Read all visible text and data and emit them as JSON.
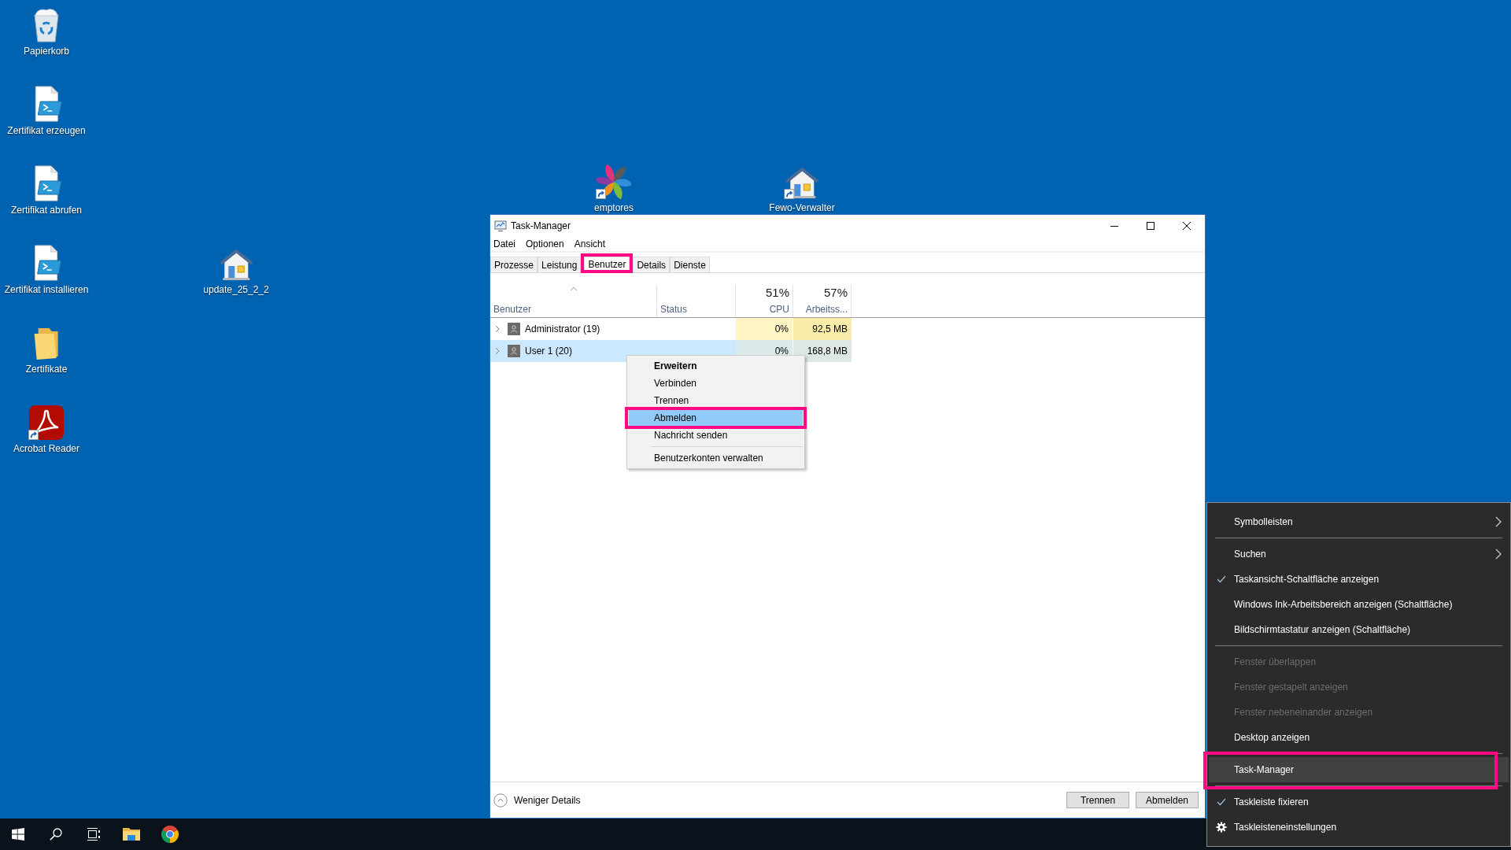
{
  "desktop_icons": [
    {
      "label": "Papierkorb",
      "kind": "recycle-bin",
      "shortcut": false
    },
    {
      "label": "Zertifikat erzeugen",
      "kind": "script",
      "shortcut": false
    },
    {
      "label": "Zertifikat abrufen",
      "kind": "script",
      "shortcut": false
    },
    {
      "label": "Zertifikat installieren",
      "kind": "script",
      "shortcut": false
    },
    {
      "label": "Zertifikate",
      "kind": "folder",
      "shortcut": false
    },
    {
      "label": "Acrobat Reader",
      "kind": "pdf-reader",
      "shortcut": true
    },
    {
      "label": "update_25_2_2",
      "kind": "house",
      "shortcut": false
    },
    {
      "label": "emptores",
      "kind": "pinwheel",
      "shortcut": true
    },
    {
      "label": "Fewo-Verwalter",
      "kind": "house",
      "shortcut": true
    }
  ],
  "task_manager": {
    "title": "Task-Manager",
    "menu": [
      "Datei",
      "Optionen",
      "Ansicht"
    ],
    "tabs": [
      {
        "label": "Prozesse",
        "selected": false,
        "framed": false
      },
      {
        "label": "Leistung",
        "selected": false,
        "framed": false
      },
      {
        "label": "Benutzer",
        "selected": true,
        "framed": true
      },
      {
        "label": "Details",
        "selected": false,
        "framed": false
      },
      {
        "label": "Dienste",
        "selected": false,
        "framed": false
      }
    ],
    "columns": [
      {
        "label": "Benutzer",
        "kind": "text",
        "sorted": true
      },
      {
        "label": "Status",
        "kind": "text",
        "sorted": false
      },
      {
        "label": "CPU",
        "kind": "metric",
        "total": "51%",
        "sorted": false
      },
      {
        "label": "Arbeitss...",
        "kind": "metric",
        "total": "57%",
        "sorted": false
      }
    ],
    "rows": [
      {
        "name": "Administrator (19)",
        "cpu": "0%",
        "memory": "92,5 MB",
        "expanded": false,
        "selected": false
      },
      {
        "name": "User 1 (20)",
        "cpu": "0%",
        "memory": "168,8 MB",
        "expanded": false,
        "selected": true
      }
    ],
    "footer": {
      "toggle": "Weniger Details",
      "buttons": [
        "Trennen",
        "Abmelden"
      ]
    }
  },
  "user_context_menu": {
    "sections": [
      [
        {
          "label": "Erweitern",
          "default": true,
          "selected": false,
          "framed": false
        },
        {
          "label": "Verbinden",
          "default": false,
          "selected": false,
          "framed": false
        },
        {
          "label": "Trennen",
          "default": false,
          "selected": false,
          "framed": false
        },
        {
          "label": "Abmelden",
          "default": false,
          "selected": true,
          "framed": true
        },
        {
          "label": "Nachricht senden",
          "default": false,
          "selected": false,
          "framed": false
        }
      ],
      [
        {
          "label": "Benutzerkonten verwalten",
          "default": false,
          "selected": false,
          "framed": false
        }
      ]
    ]
  },
  "taskbar_menu": {
    "sections": [
      [
        {
          "label": "Symbolleisten",
          "kind": "submenu",
          "checked": false,
          "disabled": false,
          "selected": false,
          "framed": false
        }
      ],
      [
        {
          "label": "Suchen",
          "kind": "submenu",
          "checked": false,
          "disabled": false,
          "selected": false,
          "framed": false
        },
        {
          "label": "Taskansicht-Schaltfläche anzeigen",
          "kind": "command",
          "checked": true,
          "disabled": false,
          "selected": false,
          "framed": false
        },
        {
          "label": "Windows Ink-Arbeitsbereich anzeigen (Schaltfläche)",
          "kind": "command",
          "checked": false,
          "disabled": false,
          "selected": false,
          "framed": false
        },
        {
          "label": "Bildschirmtastatur anzeigen (Schaltfläche)",
          "kind": "command",
          "checked": false,
          "disabled": false,
          "selected": false,
          "framed": false
        }
      ],
      [
        {
          "label": "Fenster überlappen",
          "kind": "command",
          "checked": false,
          "disabled": true,
          "selected": false,
          "framed": false
        },
        {
          "label": "Fenster gestapelt anzeigen",
          "kind": "command",
          "checked": false,
          "disabled": true,
          "selected": false,
          "framed": false
        },
        {
          "label": "Fenster nebeneinander anzeigen",
          "kind": "command",
          "checked": false,
          "disabled": true,
          "selected": false,
          "framed": false
        },
        {
          "label": "Desktop anzeigen",
          "kind": "command",
          "checked": false,
          "disabled": false,
          "selected": false,
          "framed": false
        }
      ],
      [
        {
          "label": "Task-Manager",
          "kind": "command",
          "checked": false,
          "disabled": false,
          "selected": true,
          "framed": true
        }
      ],
      [
        {
          "label": "Taskleiste fixieren",
          "kind": "command",
          "checked": true,
          "disabled": false,
          "selected": false,
          "framed": false
        },
        {
          "label": "Taskleisteneinstellungen",
          "kind": "settings",
          "checked": false,
          "disabled": false,
          "selected": false,
          "framed": false
        }
      ]
    ]
  }
}
